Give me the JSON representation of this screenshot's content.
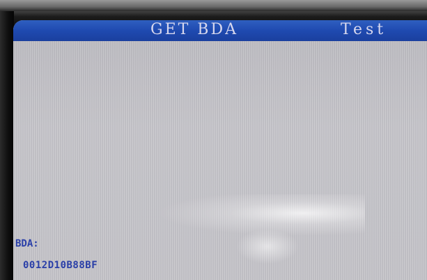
{
  "title_bar": {
    "title": "GET BDA",
    "right_label": "Test",
    "color": "#1f4ab0"
  },
  "content": {
    "field_label": "BDA:",
    "field_value": "0012D10B88BF",
    "text_color": "#2a3fa8"
  },
  "screen": {
    "background_color": "#c3c2c6"
  }
}
